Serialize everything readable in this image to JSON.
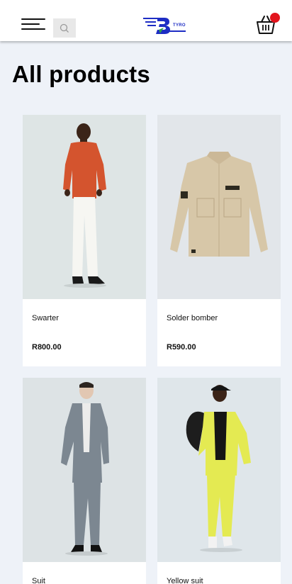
{
  "header": {
    "logo_text": "TYRO"
  },
  "page": {
    "title": "All products"
  },
  "products": [
    {
      "name": "Swarter",
      "price": "R800.00"
    },
    {
      "name": "Solder bomber",
      "price": "R590.00"
    },
    {
      "name": "Suit",
      "price": ""
    },
    {
      "name": "Yellow suit",
      "price": ""
    }
  ],
  "colors": {
    "accent": "#1d2dc4",
    "badge": "#e2141d",
    "background": "#eef2f8"
  },
  "icons": [
    "menu-icon",
    "search-icon",
    "logo-icon",
    "cart-icon"
  ]
}
